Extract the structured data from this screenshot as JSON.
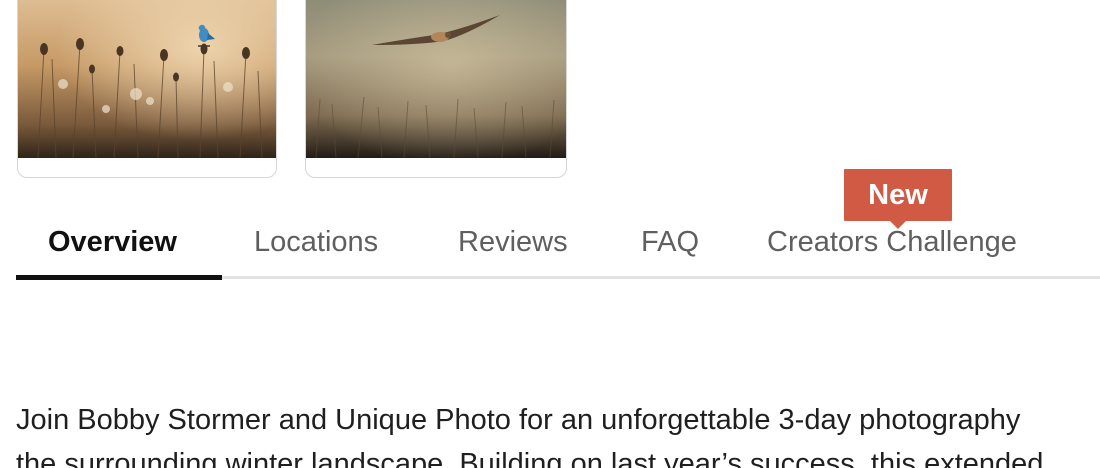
{
  "gallery": {
    "items": [
      {
        "subject": "blue bird perched on dried wildflowers in golden light"
      },
      {
        "subject": "hawk flying low over a winter meadow"
      }
    ]
  },
  "tabs": [
    {
      "label": "Overview",
      "active": true
    },
    {
      "label": "Locations",
      "active": false
    },
    {
      "label": "Reviews",
      "active": false
    },
    {
      "label": "FAQ",
      "active": false
    },
    {
      "label": "Creators Challenge",
      "active": false,
      "badge": "New"
    }
  ],
  "colors": {
    "badge": "#d05a43",
    "active_tab": "#111111",
    "inactive_tab": "#5f5f5f",
    "divider": "#e3e3e3"
  },
  "description": {
    "line1": "Join Bobby Stormer and Unique Photo for an unforgettable 3-day photography",
    "line2": "the surrounding winter landscape. Building on last year’s success, this extended"
  }
}
